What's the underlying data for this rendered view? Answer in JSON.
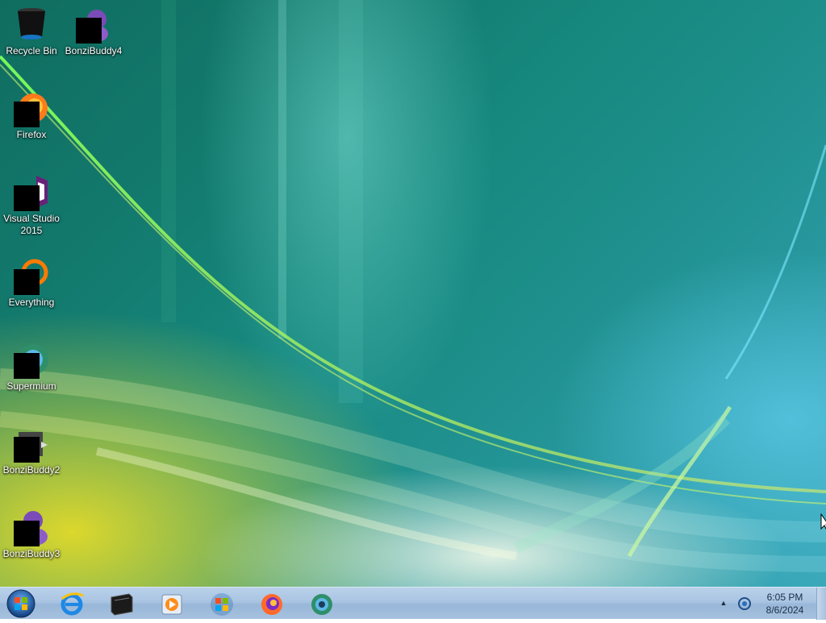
{
  "desktop": {
    "icons": [
      {
        "label": "Recycle Bin",
        "icon": "recycle-bin-icon"
      },
      {
        "label": "BonziBuddy4",
        "icon": "bonzibuddy-icon"
      },
      {
        "label": "Firefox",
        "icon": "firefox-icon"
      },
      {
        "label": "Visual Studio 2015",
        "icon": "visual-studio-icon"
      },
      {
        "label": "Everything",
        "icon": "everything-search-icon"
      },
      {
        "label": "Supermium",
        "icon": "supermium-icon"
      },
      {
        "label": "BonziBuddy2",
        "icon": "bonzibuddy-icon"
      },
      {
        "label": "BonziBuddy3",
        "icon": "bonzibuddy-icon"
      }
    ]
  },
  "taskbar": {
    "start": {
      "icon": "windows-orb-icon"
    },
    "pinned": [
      {
        "icon": "internet-explorer-icon"
      },
      {
        "icon": "command-prompt-icon"
      },
      {
        "icon": "windows-media-player-icon"
      },
      {
        "icon": "windows-logo-icon"
      },
      {
        "icon": "firefox-icon"
      },
      {
        "icon": "supermium-icon"
      }
    ],
    "tray": {
      "overflow_icon": "chevron-up-icon",
      "network_icon": "network-icon",
      "time": "6:05 PM",
      "date": "8/6/2024"
    }
  },
  "colors": {
    "taskbar": "#a9c4e2",
    "desktop_teal": "#17897f",
    "glow_yellow": "#e6dc28"
  }
}
